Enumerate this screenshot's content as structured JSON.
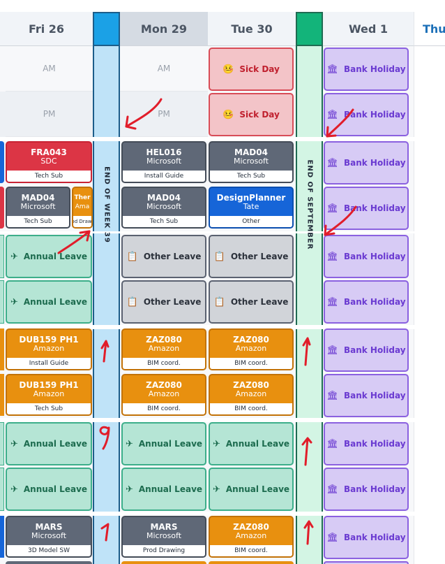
{
  "days": [
    {
      "label": "Fri 26"
    },
    {
      "label": "Mon 29"
    },
    {
      "label": "Tue 30"
    },
    {
      "label": "Wed 1"
    },
    {
      "label": "Thu"
    }
  ],
  "rows": {
    "am": "AM",
    "pm": "PM"
  },
  "markers": {
    "week": "END OF WEEK 39",
    "month": "END OF SEPTEMBER"
  },
  "colors": {
    "week_marker": "#1ba1e6",
    "month_marker": "#13b47a",
    "annotation": "#e11d2a"
  },
  "leave": {
    "sick": "Sick Day",
    "annual": "Annual Leave",
    "other": "Other Leave",
    "bank": "Bank Holiday"
  },
  "jobs": {
    "fra043": {
      "code": "FRA043",
      "client": "SDC",
      "task": "Tech Sub"
    },
    "mad04_a": {
      "code": "MAD04",
      "client": "Microsoft",
      "task": "Tech Sub"
    },
    "ther": {
      "code": "Ther",
      "client": "Ama",
      "task": "od Drawi"
    },
    "dub159_a": {
      "code": "DUB159 PH1",
      "client": "Amazon",
      "task": "Install Guide"
    },
    "dub159_b": {
      "code": "DUB159 PH1",
      "client": "Amazon",
      "task": "Tech Sub"
    },
    "mars_a": {
      "code": "MARS",
      "client": "Microsoft",
      "task": "3D Model SW"
    },
    "hel016": {
      "code": "HEL016",
      "client": "Microsoft",
      "task": "Install Guide"
    },
    "mad04_b": {
      "code": "MAD04",
      "client": "Microsoft",
      "task": "Tech Sub"
    },
    "zaz080_a": {
      "code": "ZAZ080",
      "client": "Amazon",
      "task": "BIM coord."
    },
    "zaz080_b": {
      "code": "ZAZ080",
      "client": "Amazon",
      "task": "BIM coord."
    },
    "mars_b": {
      "code": "MARS",
      "client": "Microsoft",
      "task": "Prod Drawing"
    },
    "mad04_c": {
      "code": "MAD04",
      "client": "Microsoft",
      "task": "Tech Sub"
    },
    "designplanner": {
      "code": "DesignPlanner",
      "client": "Tate",
      "task": "Other"
    },
    "zaz080_c": {
      "code": "ZAZ080",
      "client": "Amazon",
      "task": "BIM coord."
    },
    "zaz080_d": {
      "code": "ZAZ080",
      "client": "Amazon",
      "task": "BIM coord."
    },
    "zaz080_e": {
      "code": "ZAZ080",
      "client": "Amazon",
      "task": "BIM coord."
    }
  }
}
